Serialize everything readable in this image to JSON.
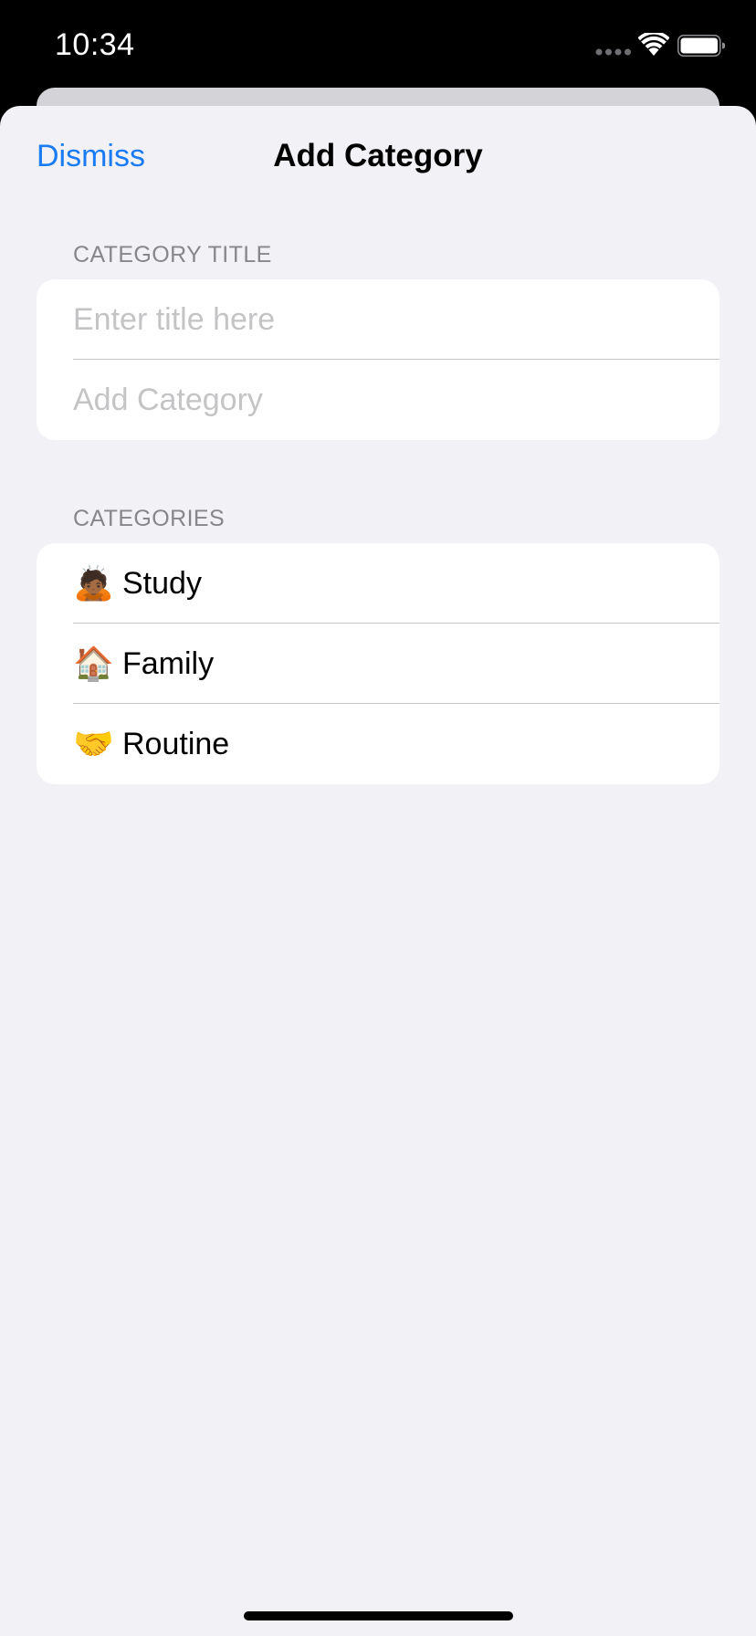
{
  "status_bar": {
    "time": "10:34",
    "icons": [
      "cellular-signal-icon",
      "wifi-icon",
      "battery-icon"
    ]
  },
  "nav": {
    "dismiss_label": "Dismiss",
    "title": "Add Category"
  },
  "title_section": {
    "header": "CATEGORY TITLE",
    "input_placeholder": "Enter title here",
    "input_value": "",
    "add_label": "Add Category"
  },
  "categories_section": {
    "header": "CATEGORIES",
    "items": [
      {
        "emoji": "🙇🏾",
        "label": "Study"
      },
      {
        "emoji": "🏠",
        "label": "Family"
      },
      {
        "emoji": "🤝",
        "label": "Routine"
      }
    ]
  },
  "colors": {
    "accent": "#1a7cf4",
    "background": "#f1f1f6",
    "card": "#ffffff",
    "secondary_text": "#86868b",
    "placeholder": "#c4c4c6"
  }
}
